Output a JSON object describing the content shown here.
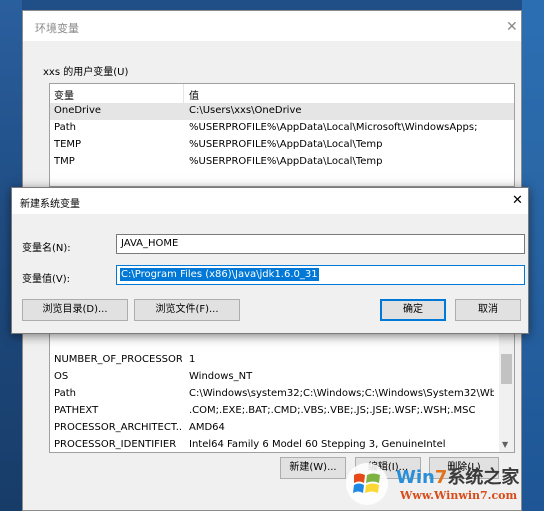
{
  "parent_window": {
    "title": "环境变量",
    "close_icon": "✕",
    "user_section_label": "xxs 的用户变量(U)",
    "columns": {
      "var": "变量",
      "value": "值"
    },
    "user_vars": [
      {
        "name": "OneDrive",
        "value": "C:\\Users\\xxs\\OneDrive"
      },
      {
        "name": "Path",
        "value": "%USERPROFILE%\\AppData\\Local\\Microsoft\\WindowsApps;"
      },
      {
        "name": "TEMP",
        "value": "%USERPROFILE%\\AppData\\Local\\Temp"
      },
      {
        "name": "TMP",
        "value": "%USERPROFILE%\\AppData\\Local\\Temp"
      }
    ],
    "system_vars": [
      {
        "name": "NUMBER_OF_PROCESSORS",
        "value": "1"
      },
      {
        "name": "OS",
        "value": "Windows_NT"
      },
      {
        "name": "Path",
        "value": "C:\\Windows\\system32;C:\\Windows;C:\\Windows\\System32\\Wb..."
      },
      {
        "name": "PATHEXT",
        "value": ".COM;.EXE;.BAT;.CMD;.VBS;.VBE;.JS;.JSE;.WSF;.WSH;.MSC"
      },
      {
        "name": "PROCESSOR_ARCHITECT...",
        "value": "AMD64"
      },
      {
        "name": "PROCESSOR_IDENTIFIER",
        "value": "Intel64 Family 6 Model 60 Stepping 3, GenuineIntel"
      }
    ],
    "buttons": {
      "new": "新建(W)...",
      "edit": "编辑(I)...",
      "delete": "删除(L)"
    }
  },
  "dialog": {
    "title": "新建系统变量",
    "close_icon": "✕",
    "name_label": "变量名(N):",
    "name_value": "JAVA_HOME",
    "value_label": "变量值(V):",
    "value_value": "C:\\Program Files (x86)\\Java\\jdk1.6.0_31",
    "browse_dir": "浏览目录(D)...",
    "browse_file": "浏览文件(F)...",
    "ok": "确定",
    "cancel": "取消"
  },
  "watermark": {
    "brand_win": "Win",
    "brand_7": "7",
    "brand_rest": "系统之家",
    "url": "Www.Winwin7.com"
  },
  "colors": {
    "accent": "#0078d7",
    "desktop": "#1f4f86"
  }
}
